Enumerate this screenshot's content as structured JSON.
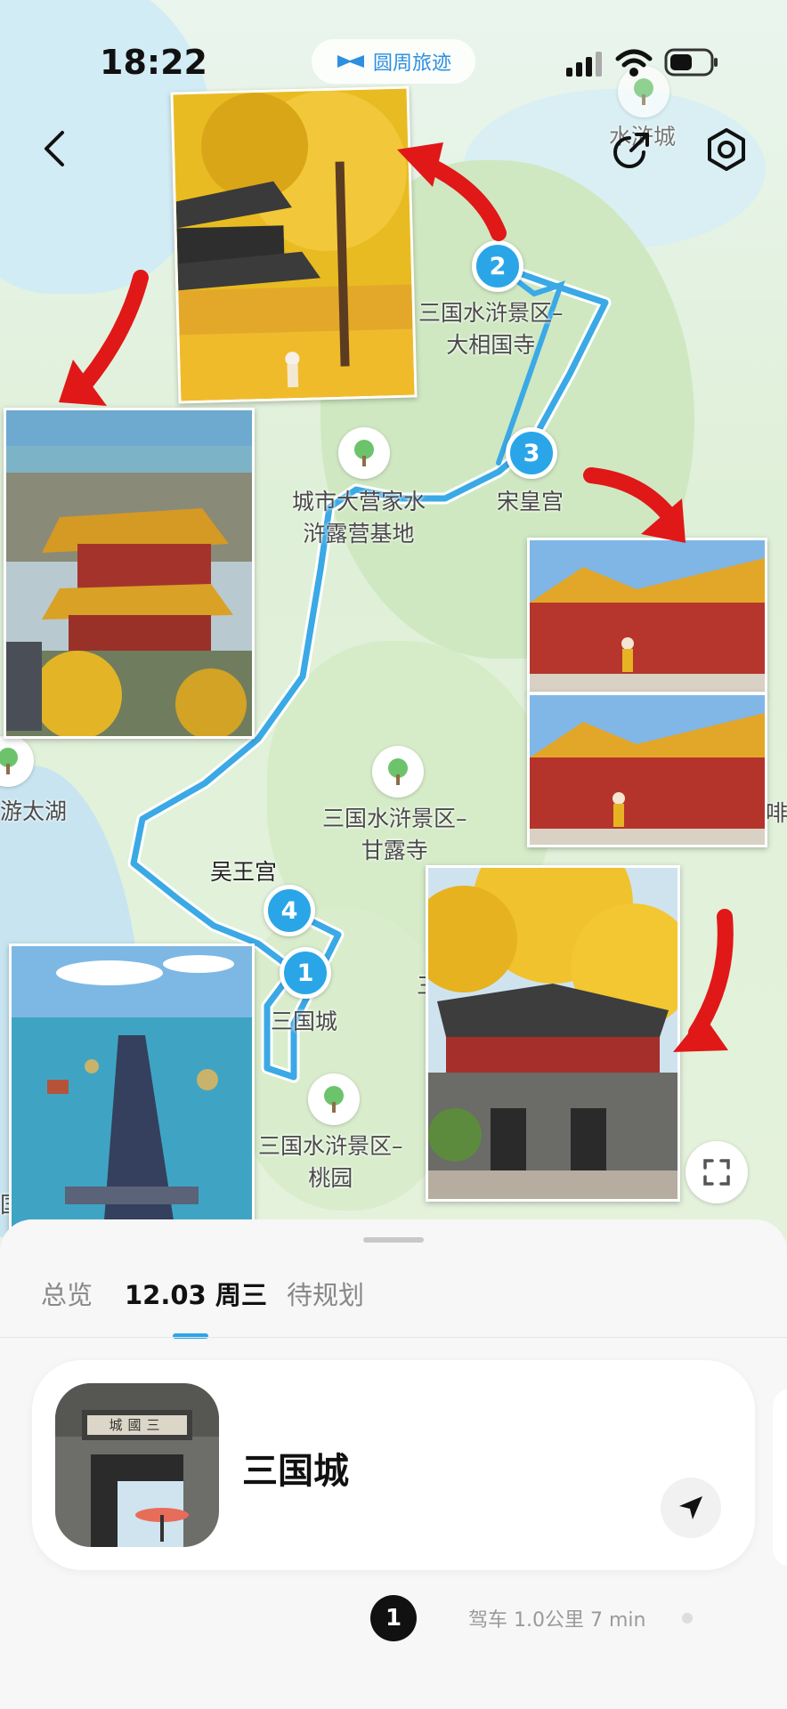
{
  "status_bar": {
    "time": "18:22"
  },
  "brand": {
    "name": "圆周旅迹"
  },
  "map": {
    "labels": {
      "top_right_place": "水浒城",
      "stop2": "三国水浒景区–\n大相国寺",
      "stop3": "宋皇宫",
      "camp": "城市大营家水\n浒露营基地",
      "lake": "游太湖",
      "ganlu": "三国水浒景区–\n甘露寺",
      "wuwang": "吴王宫",
      "sanguocheng": "三国城",
      "taoyuan": "三国水浒景区–\n桃园",
      "right_edge": "啡",
      "left_edge": "国",
      "mid_partial": "三"
    },
    "markers": [
      "1",
      "2",
      "3",
      "4"
    ]
  },
  "tabs": [
    {
      "label": "总览",
      "active": false
    },
    {
      "label": "12.03 周三",
      "active": true
    },
    {
      "label": "待规划",
      "active": false
    }
  ],
  "place_card": {
    "name": "三国城",
    "gate_sign": "城國三"
  },
  "route_info": {
    "step": "1",
    "text": "驾车 1.0公里 7 min"
  },
  "colors": {
    "route": "#3aa9e6",
    "marker": "#2aa6e8",
    "arrow": "#e01818",
    "brand": "#2d8fe0"
  }
}
